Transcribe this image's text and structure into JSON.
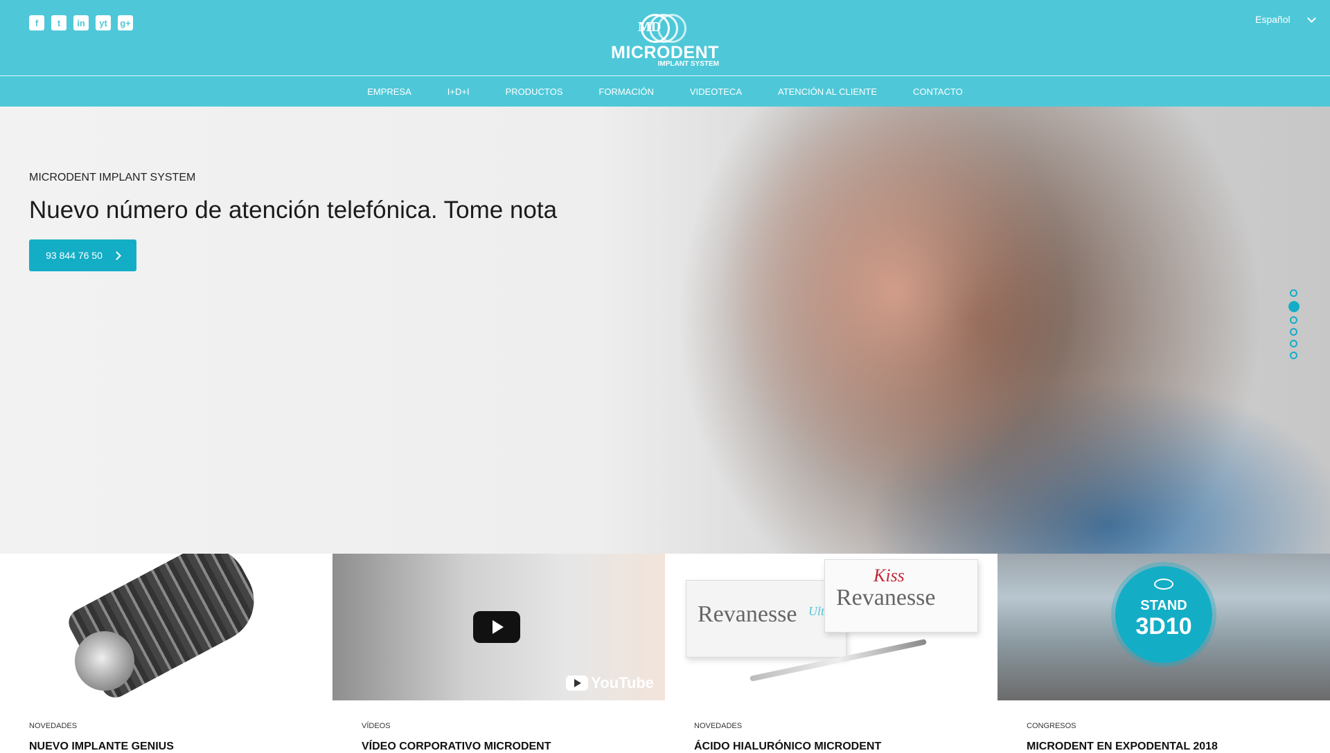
{
  "header": {
    "social_icons": [
      "facebook-icon",
      "twitter-icon",
      "linkedin-icon",
      "youtube-icon",
      "google-plus-icon"
    ],
    "social_glyphs": [
      "f",
      "t",
      "in",
      "yt",
      "g+"
    ],
    "logo": {
      "monogram": "MD",
      "name": "MICRODENT",
      "subtitle": "IMPLANT SYSTEM"
    },
    "language": "Español",
    "nav": [
      "EMPRESA",
      "I+D+I",
      "PRODUCTOS",
      "FORMACIÓN",
      "VIDEOTECA",
      "ATENCIÓN AL CLIENTE",
      "CONTACTO"
    ]
  },
  "hero": {
    "eyebrow": "MICRODENT IMPLANT SYSTEM",
    "headline": "Nuevo número de atención telefónica. Tome nota",
    "cta_label": "93 844 76 50",
    "slide_count": 6,
    "active_slide": 2
  },
  "cards": [
    {
      "category": "NOVEDADES",
      "title": "NUEVO IMPLANTE GENIUS"
    },
    {
      "category": "VÍDEOS",
      "title": "VÍDEO CORPORATIVO MICRODENT",
      "overlay_text": "YouTube"
    },
    {
      "category": "NOVEDADES",
      "title": "ÁCIDO HIALURÓNICO MICRODENT",
      "box_texts": [
        "Revanesse",
        "Ultra",
        "Revanesse",
        "Kiss"
      ]
    },
    {
      "category": "CONGRESOS",
      "title": "MICRODENT EN EXPODENTAL 2018",
      "badge": [
        "STAND",
        "3D10"
      ]
    }
  ],
  "colors": {
    "header": "#4ec8d8",
    "accent": "#14adc6"
  }
}
